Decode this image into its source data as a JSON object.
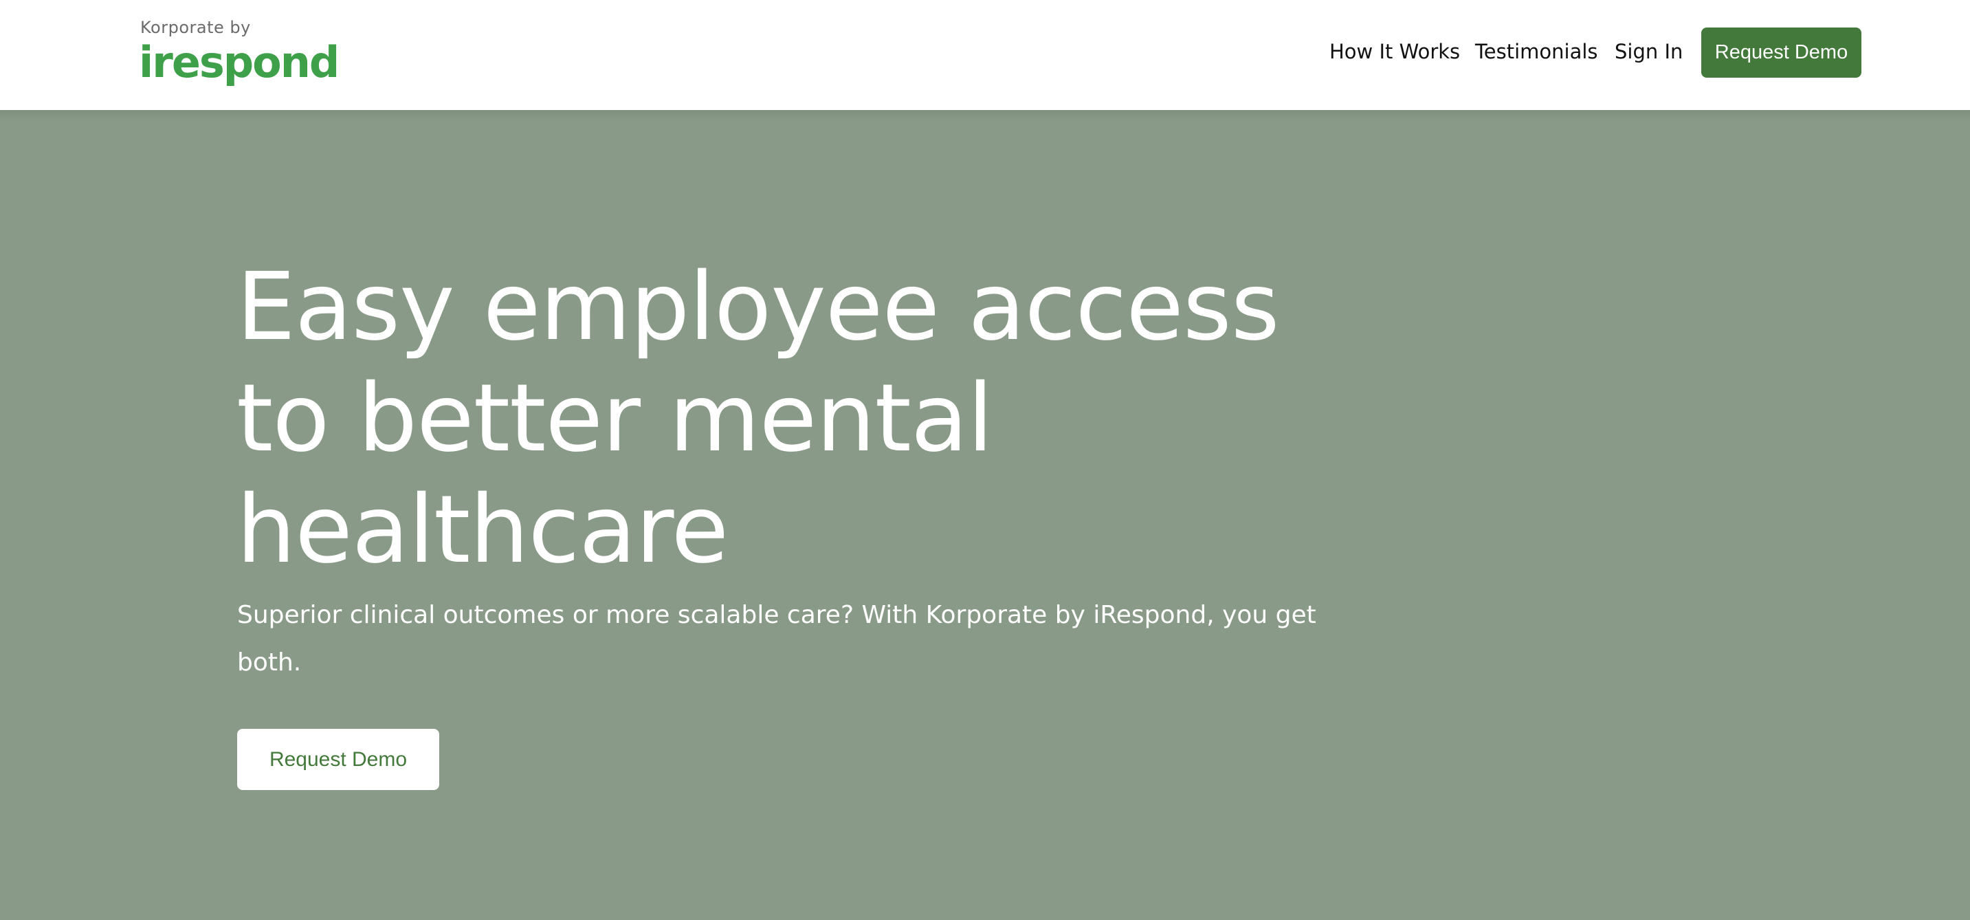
{
  "logo": {
    "sub": "Korporate by",
    "main": "irespond"
  },
  "nav": {
    "links": [
      "How It Works",
      "Testimonials",
      "Sign In"
    ],
    "cta": "Request Demo"
  },
  "hero": {
    "title_lines": [
      "Easy employee access",
      "to better mental",
      "healthcare"
    ],
    "subtitle": "Superior clinical outcomes or more scalable care? With Korporate by iRespond, you get both.",
    "cta": "Request Demo"
  },
  "colors": {
    "brand_green": "#3fa04a",
    "button_green": "#43793a",
    "hero_background": "#8a9a88"
  }
}
